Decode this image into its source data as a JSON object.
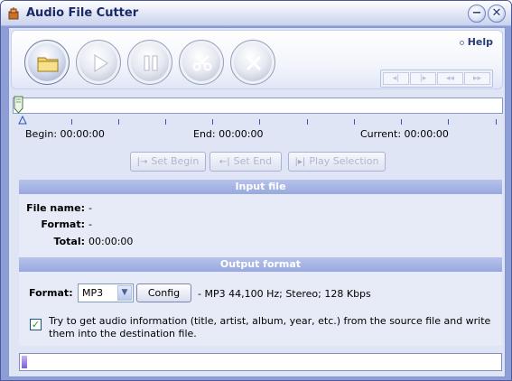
{
  "window": {
    "title": "Audio File Cutter",
    "minimize_glyph": "−",
    "close_glyph": "✕"
  },
  "toolbar": {
    "help_label": "Help",
    "buttons": [
      {
        "name": "open-folder",
        "icon": "folder-icon"
      },
      {
        "name": "play",
        "icon": "play-icon"
      },
      {
        "name": "pause",
        "icon": "pause-icon"
      },
      {
        "name": "cut",
        "icon": "scissors-icon"
      },
      {
        "name": "stop",
        "icon": "stop-icon"
      }
    ],
    "nav": [
      {
        "name": "prev",
        "glyph": "◂|"
      },
      {
        "name": "next",
        "glyph": "|▸"
      },
      {
        "name": "rewind",
        "glyph": "◂◂"
      },
      {
        "name": "forward",
        "glyph": "▸▸"
      }
    ]
  },
  "timeline": {
    "begin_label": "Begin: 00:00:00",
    "end_label": "End: 00:00:00",
    "current_label": "Current: 00:00:00"
  },
  "actions": {
    "set_begin": "Set Begin",
    "set_end": "Set End",
    "play_selection": "Play Selection"
  },
  "input_file": {
    "header": "Input file",
    "file_name_label": "File name:",
    "file_name_value": "-",
    "format_label": "Format:",
    "format_value": "-",
    "total_label": "Total:",
    "total_value": "00:00:00"
  },
  "output_format": {
    "header": "Output format",
    "format_label": "Format:",
    "format_selected": "MP3",
    "config_label": "Config",
    "format_info": "- MP3 44,100 Hz; Stereo;  128 Kbps",
    "checkbox_checked": true,
    "checkbox_text": "Try to get audio information (title, artist, album, year, etc.) from the source file and write them into the destination file."
  },
  "progress": {
    "value": 0.01
  },
  "colors": {
    "accent": "#98a8df",
    "frame": "#8d9ed6",
    "panel": "#e7ebf7"
  }
}
